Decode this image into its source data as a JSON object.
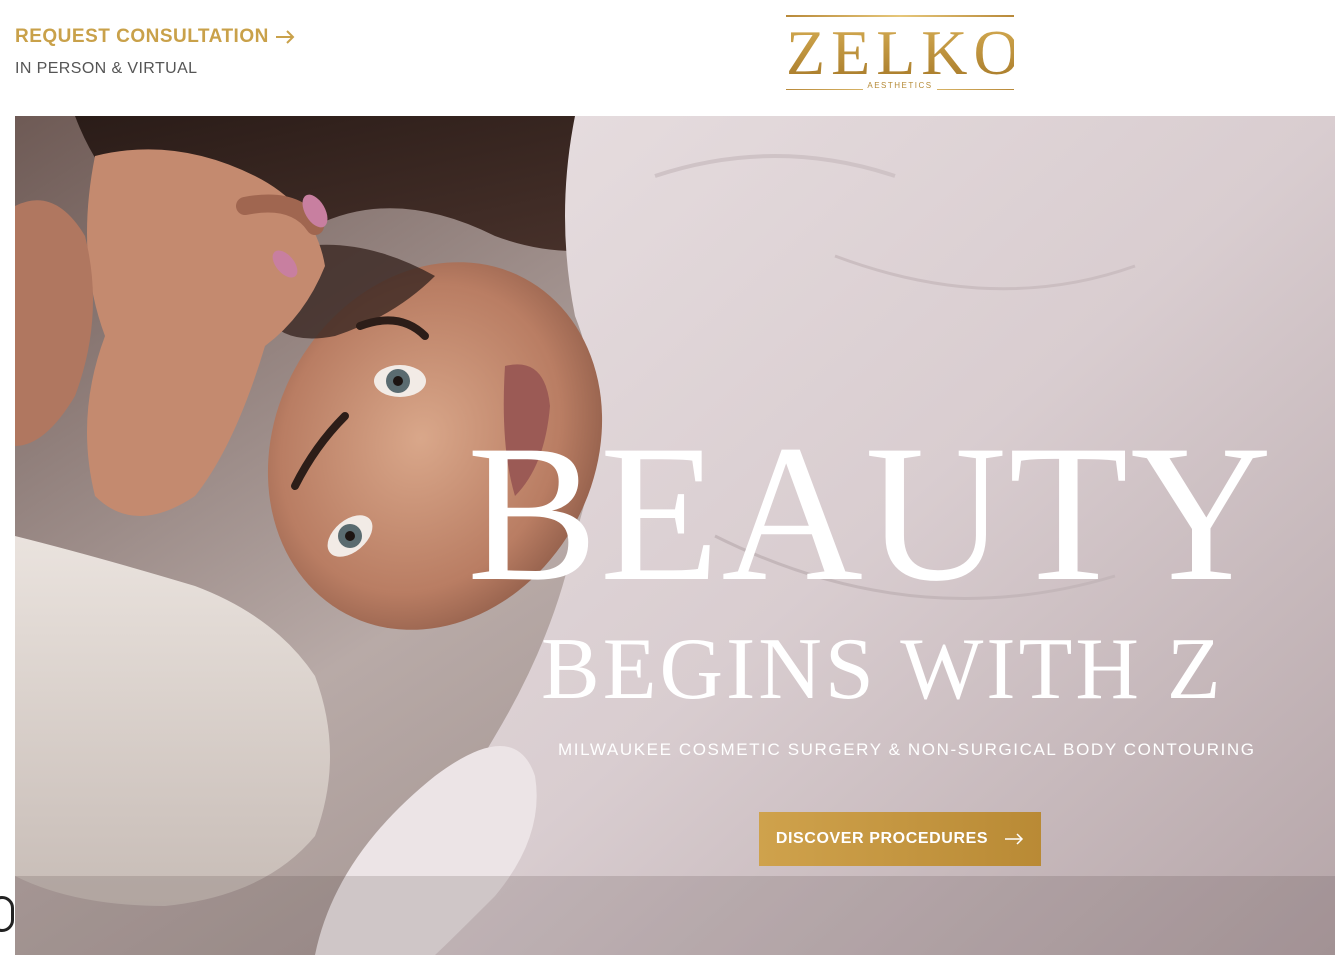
{
  "header": {
    "consult_label": "REQUEST CONSULTATION",
    "consult_sub": "IN PERSON & VIRTUAL",
    "logo_wordmark": "ZELKO",
    "logo_tagline": "AESTHETICS"
  },
  "hero": {
    "title": "BEAUTY",
    "subtitle": "BEGINS WITH Z",
    "tagline": "MILWAUKEE COSMETIC SURGERY & NON-SURGICAL BODY CONTOURING",
    "cta_label": "DISCOVER PROCEDURES"
  },
  "colors": {
    "accent_gold": "#c9a14a",
    "text_gray": "#555555",
    "hero_text": "#ffffff"
  },
  "icons": {
    "consult_arrow": "arrow-right-icon",
    "cta_arrow": "arrow-right-icon",
    "a11y": "accessibility-icon"
  }
}
